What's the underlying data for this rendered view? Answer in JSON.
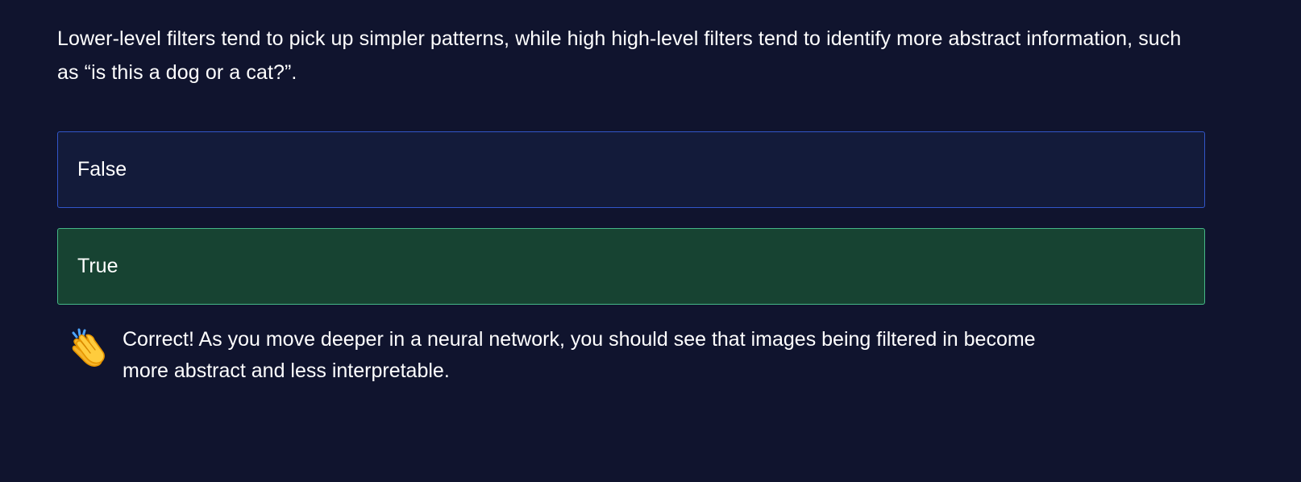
{
  "question": {
    "text": "Lower-level filters tend to pick up simpler patterns, while high high-level filters tend to identify more abstract information, such as “is this a dog or a cat?”."
  },
  "options": [
    {
      "label": "False",
      "state": "unselected",
      "accent_color": "#3156c9"
    },
    {
      "label": "True",
      "state": "correct",
      "accent_color": "#45b787"
    }
  ],
  "feedback": {
    "icon": "clapping-hands-icon",
    "text": "Correct! As you move deeper in a neural network, you should see that images being filtered in become more abstract and less interpretable."
  },
  "colors": {
    "background": "#10142e",
    "text": "#ffffff",
    "false_option_background": "#131b3a",
    "true_option_background": "#174332"
  }
}
